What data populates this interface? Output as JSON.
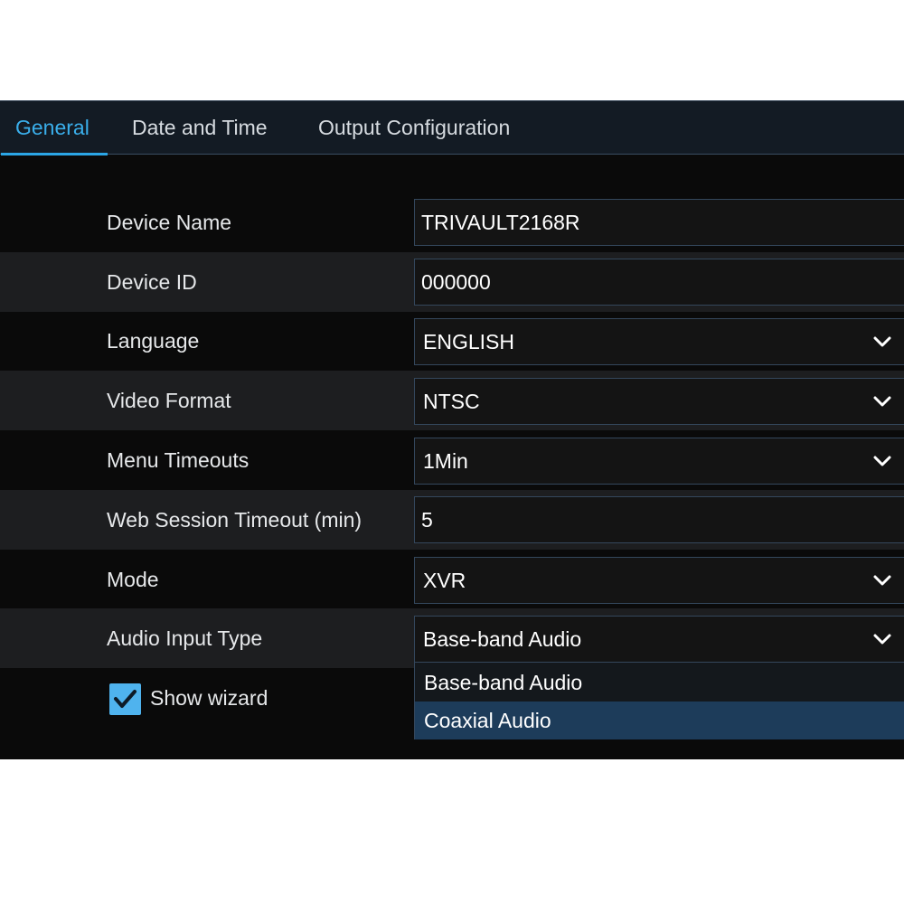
{
  "tabs": [
    {
      "label": "General",
      "active": true
    },
    {
      "label": "Date and Time",
      "active": false
    },
    {
      "label": "Output Configuration",
      "active": false
    }
  ],
  "settings": {
    "device_name": {
      "label": "Device Name",
      "value": "TRIVAULT2168R"
    },
    "device_id": {
      "label": "Device ID",
      "value": "000000"
    },
    "language": {
      "label": "Language",
      "value": "ENGLISH"
    },
    "video_format": {
      "label": "Video Format",
      "value": "NTSC"
    },
    "menu_timeouts": {
      "label": "Menu Timeouts",
      "value": "1Min"
    },
    "web_session_timeout": {
      "label": "Web Session Timeout (min)",
      "value": "5"
    },
    "mode": {
      "label": "Mode",
      "value": "XVR"
    },
    "audio_input_type": {
      "label": "Audio Input Type",
      "value": "Base-band Audio",
      "options": [
        "Base-band Audio",
        "Coaxial Audio"
      ],
      "highlighted_option": "Coaxial Audio"
    }
  },
  "show_wizard": {
    "label": "Show wizard",
    "checked": true
  },
  "colors": {
    "accent": "#3aaeea",
    "panel_bg": "#0a0a0a",
    "row_alt_bg": "#1d1e20",
    "field_border": "#34475c",
    "highlight_bg": "#1d3c5a"
  },
  "icons": {
    "select_arrow": "chevron-down-icon",
    "checkbox": "checkmark-icon"
  }
}
